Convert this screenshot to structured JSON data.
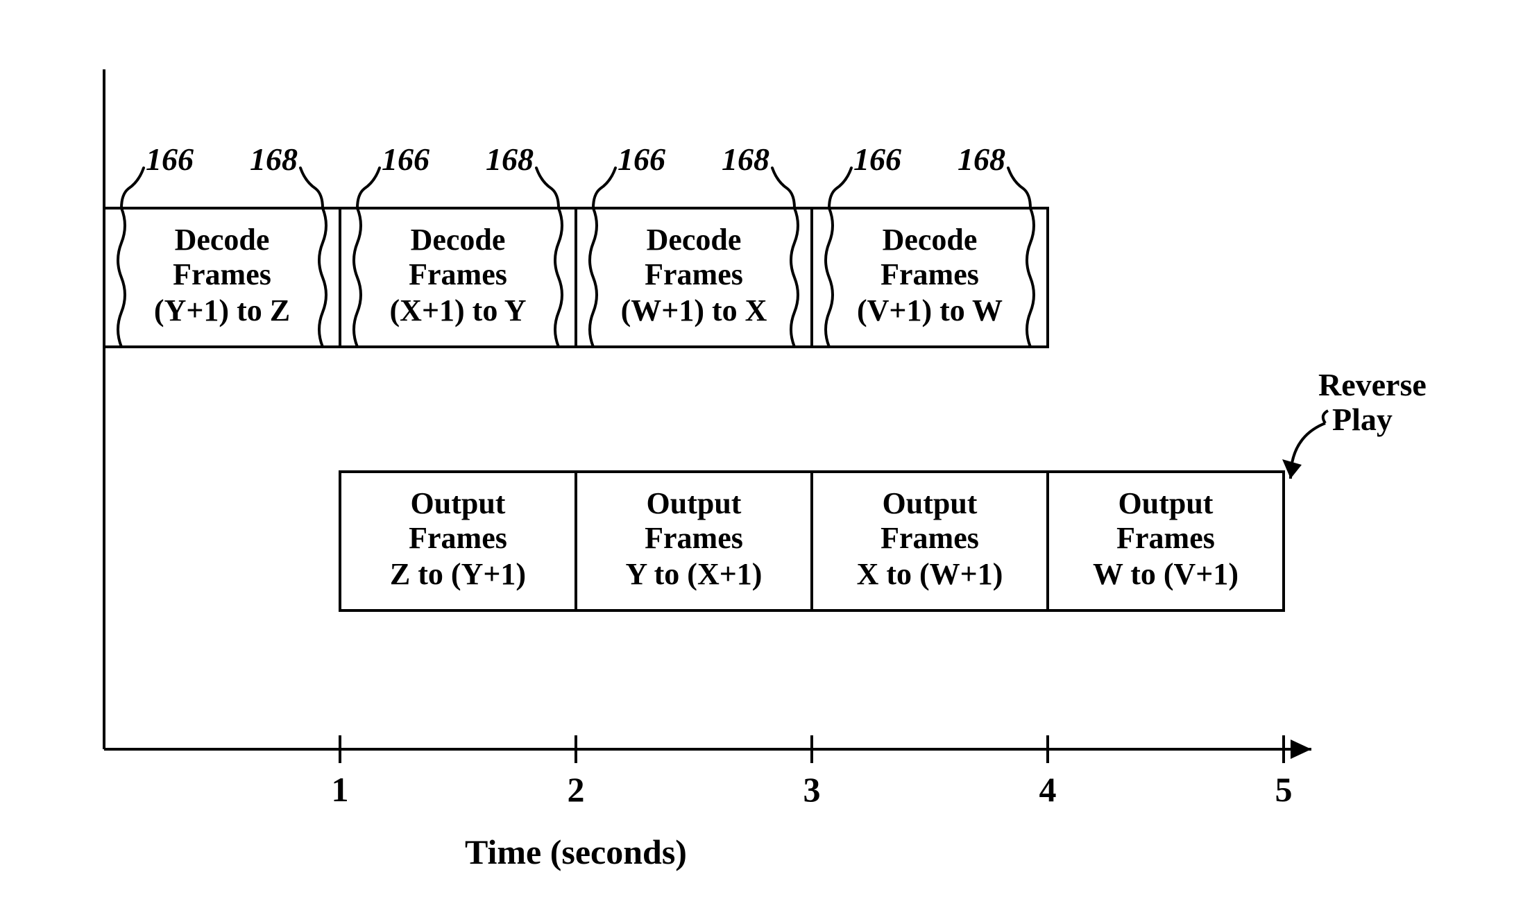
{
  "chart_data": {
    "type": "diagram-timeline",
    "title": "",
    "xlabel": "Time  (seconds)",
    "ylabel": "",
    "x_ticks": [
      "1",
      "2",
      "3",
      "4",
      "5"
    ],
    "series": [
      {
        "name": "Decode row",
        "blocks": [
          {
            "start": 0,
            "end": 1,
            "label": "Decode\nFrames\n(Y+1) to Z"
          },
          {
            "start": 1,
            "end": 2,
            "label": "Decode\nFrames\n(X+1) to Y"
          },
          {
            "start": 2,
            "end": 3,
            "label": "Decode\nFrames\n(W+1) to X"
          },
          {
            "start": 3,
            "end": 4,
            "label": "Decode\nFrames\n(V+1) to W"
          }
        ]
      },
      {
        "name": "Output row",
        "blocks": [
          {
            "start": 1,
            "end": 2,
            "label": "Output\nFrames\nZ to (Y+1)"
          },
          {
            "start": 2,
            "end": 3,
            "label": "Output\nFrames\nY to (X+1)"
          },
          {
            "start": 3,
            "end": 4,
            "label": "Output\nFrames\nX to (W+1)"
          },
          {
            "start": 4,
            "end": 5,
            "label": "Output\nFrames\nW to (V+1)"
          }
        ]
      }
    ],
    "annotations": {
      "ref_left": "166",
      "ref_right": "168",
      "right_label": "Reverse\nPlay"
    }
  },
  "decode": {
    "word1": "Decode",
    "word2": "Frames",
    "b0": "(Y+1) to Z",
    "b1": "(X+1) to Y",
    "b2": "(W+1) to X",
    "b3": "(V+1) to W"
  },
  "output": {
    "word1": "Output",
    "word2": "Frames",
    "b0": "Z to (Y+1)",
    "b1": "Y to (X+1)",
    "b2": "X to (W+1)",
    "b3": "W to (V+1)"
  },
  "ticks": {
    "t1": "1",
    "t2": "2",
    "t3": "3",
    "t4": "4",
    "t5": "5"
  },
  "axis_label": "Time  (seconds)",
  "ref_left": "166",
  "ref_right": "168",
  "right_label_l1": "Reverse",
  "right_label_l2": "Play"
}
